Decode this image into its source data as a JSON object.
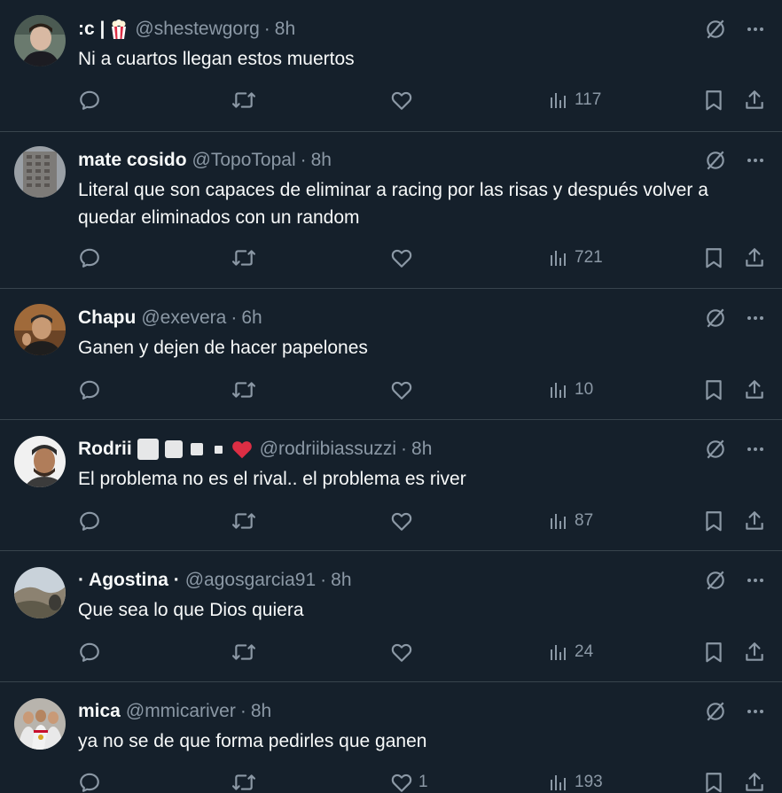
{
  "tweets": [
    {
      "name": ":c |",
      "badges": [
        "popcorn"
      ],
      "handle": "@shestewgorg",
      "time": "8h",
      "text": "Ni a cuartos llegan estos muertos",
      "replies": "",
      "retweets": "",
      "likes": "",
      "views": "117"
    },
    {
      "name": "mate cosido",
      "badges": [],
      "handle": "@TopoTopal",
      "time": "8h",
      "text": "Literal que son capaces de eliminar a racing por las risas y después volver a quedar eliminados con un random",
      "replies": "",
      "retweets": "",
      "likes": "",
      "views": "721"
    },
    {
      "name": "Chapu",
      "badges": [],
      "handle": "@exevera",
      "time": "6h",
      "text": "Ganen y dejen de hacer papelones",
      "replies": "",
      "retweets": "",
      "likes": "",
      "views": "10"
    },
    {
      "name": "Rodrii",
      "badges": [
        "white-square-large",
        "white-square-medium",
        "white-square-small",
        "white-square-tiny",
        "red-heart"
      ],
      "handle": "@rodriibiassuzzi",
      "time": "8h",
      "text": "El problema no es el rival.. el problema es river",
      "replies": "",
      "retweets": "",
      "likes": "",
      "views": "87"
    },
    {
      "name": "· Agostina ·",
      "badges": [],
      "handle": "@agosgarcia91",
      "time": "8h",
      "text": "Que sea lo que Dios quiera",
      "replies": "",
      "retweets": "",
      "likes": "",
      "views": "24"
    },
    {
      "name": "mica",
      "badges": [],
      "handle": "@mmicariver",
      "time": "8h",
      "text": "ya no se de que forma pedirles que ganen",
      "replies": "",
      "retweets": "",
      "likes": "1",
      "views": "193"
    }
  ],
  "colors": {
    "background": "#15202b",
    "divider": "#38444d",
    "text": "#f7f9f9",
    "secondary": "#8b98a5",
    "heart": "#f91880"
  },
  "icons": {
    "reply": "reply-icon",
    "retweet": "retweet-icon",
    "like": "heart-icon",
    "views": "views-icon",
    "bookmark": "bookmark-icon",
    "share": "share-icon",
    "grok": "grok-icon",
    "more": "more-icon"
  }
}
